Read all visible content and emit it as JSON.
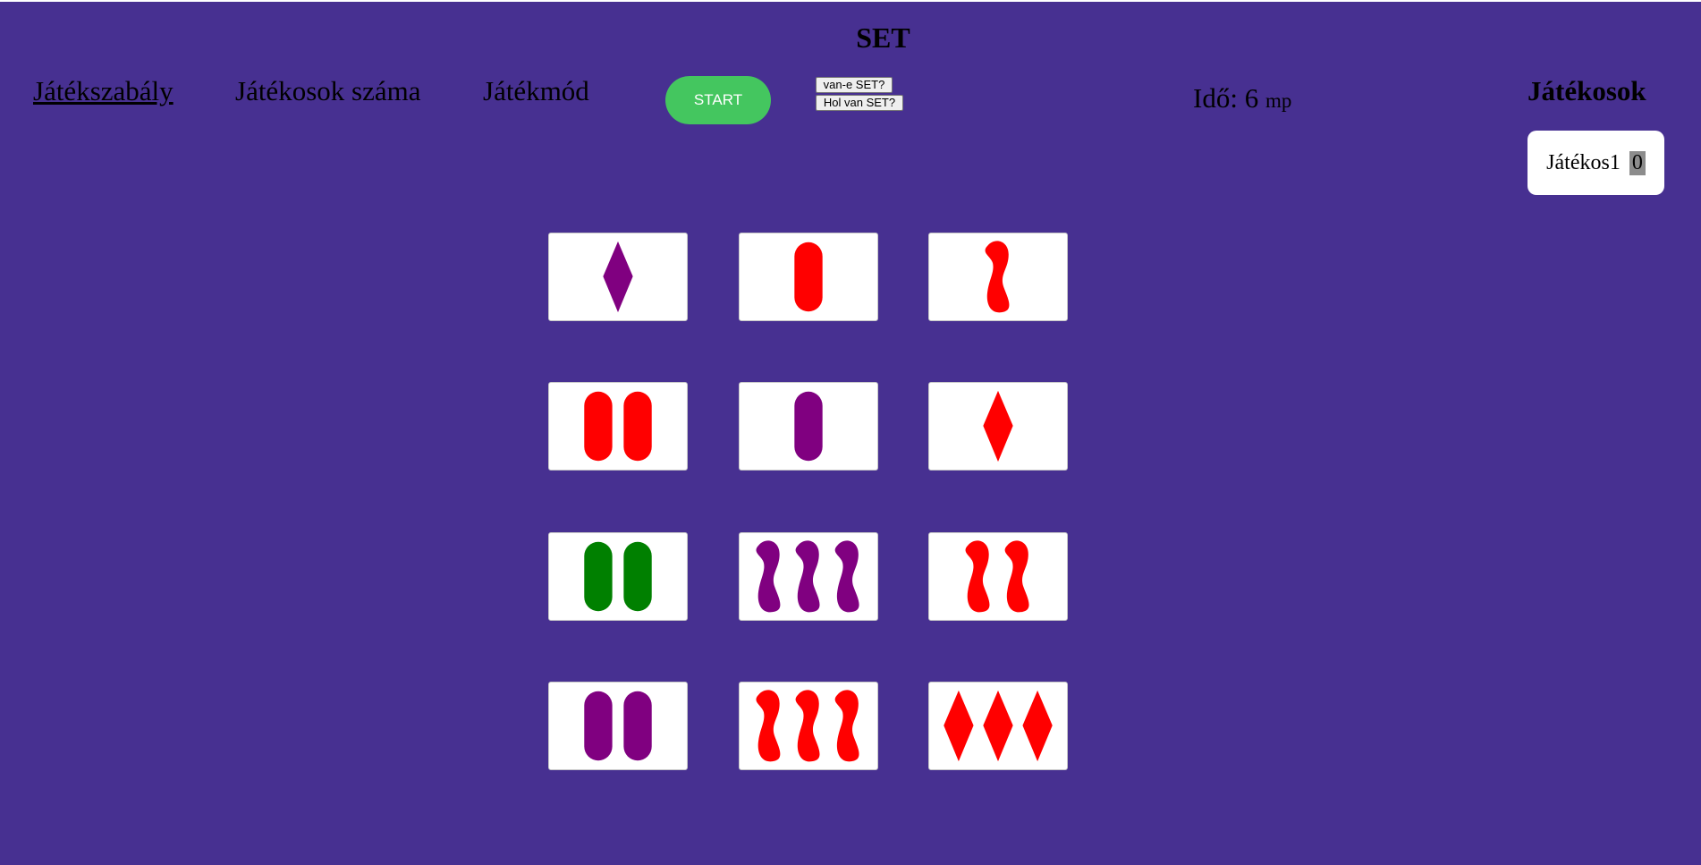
{
  "header": {
    "title": "SET"
  },
  "nav": {
    "rules": "Játékszabály",
    "players_count": "Játékosok száma",
    "mode": "Játékmód"
  },
  "controls": {
    "start": "START",
    "is_there_set": "van-e SET?",
    "where_is_set": "Hol van SET?"
  },
  "timer": {
    "label": "Idő:",
    "value": "6",
    "unit": "mp"
  },
  "players": {
    "title": "Játékosok",
    "list": [
      {
        "name": "Játékos1",
        "score": "0"
      }
    ]
  },
  "colors": {
    "red": "#ff0000",
    "purple": "#800080",
    "green": "#008000",
    "background": "#473091",
    "start": "#44c65f"
  },
  "cards": [
    {
      "count": 1,
      "shape": "diamond",
      "color": "purple"
    },
    {
      "count": 1,
      "shape": "oval",
      "color": "red"
    },
    {
      "count": 1,
      "shape": "squiggle",
      "color": "red"
    },
    {
      "count": 2,
      "shape": "oval",
      "color": "red"
    },
    {
      "count": 1,
      "shape": "oval",
      "color": "purple"
    },
    {
      "count": 1,
      "shape": "diamond",
      "color": "red"
    },
    {
      "count": 2,
      "shape": "oval",
      "color": "green"
    },
    {
      "count": 3,
      "shape": "squiggle",
      "color": "purple"
    },
    {
      "count": 2,
      "shape": "squiggle",
      "color": "red"
    },
    {
      "count": 2,
      "shape": "oval",
      "color": "purple"
    },
    {
      "count": 3,
      "shape": "squiggle",
      "color": "red"
    },
    {
      "count": 3,
      "shape": "diamond",
      "color": "red"
    }
  ]
}
